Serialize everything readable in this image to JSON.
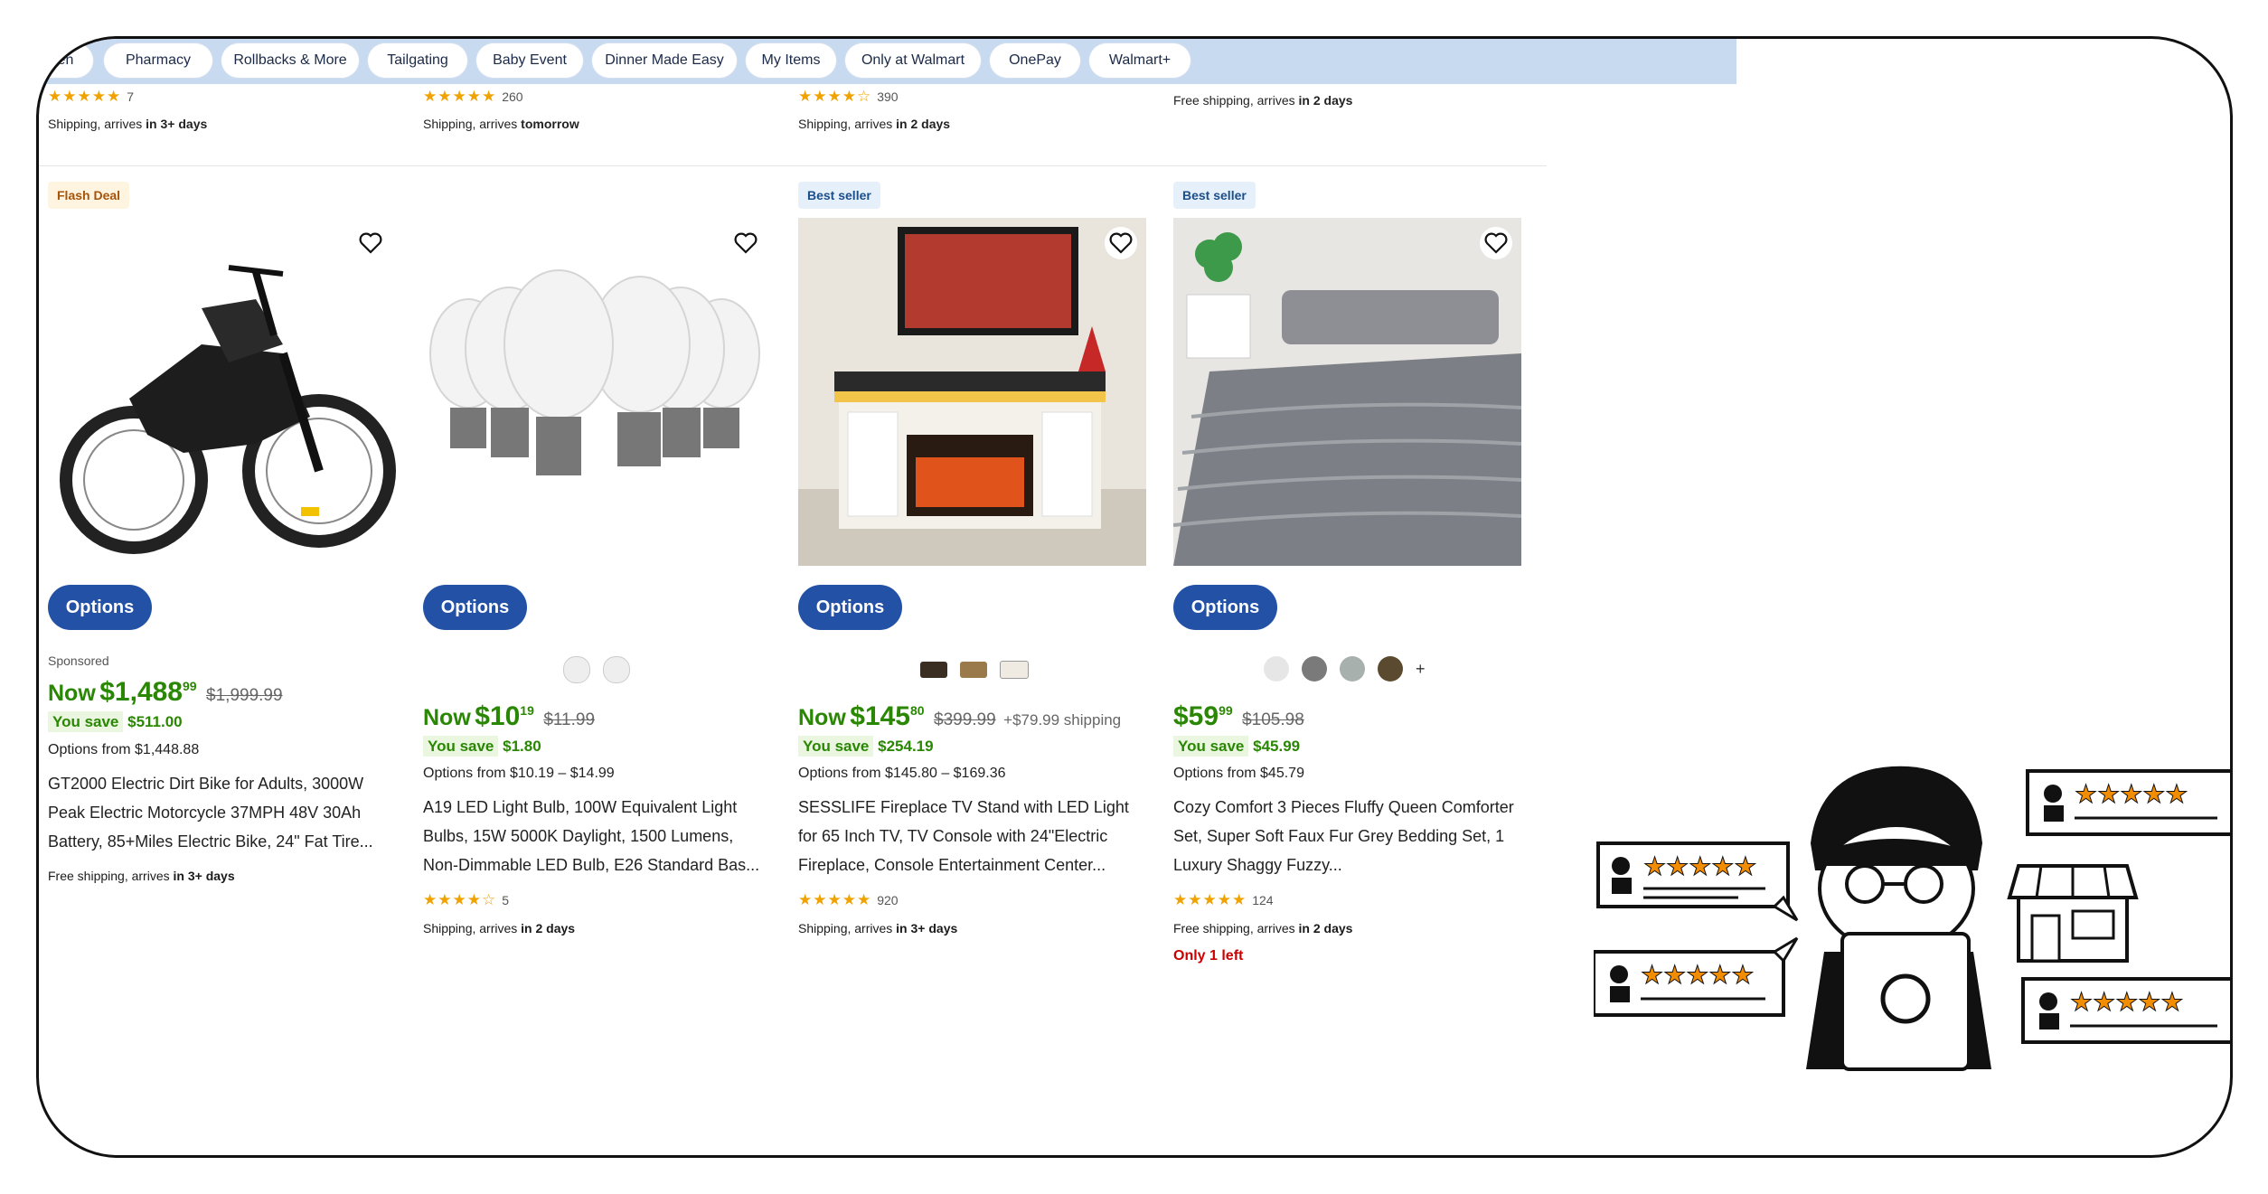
{
  "nav": {
    "items": [
      "een",
      "Pharmacy",
      "Rollbacks & More",
      "Tailgating",
      "Baby Event",
      "Dinner Made Easy",
      "My Items",
      "Only at Walmart",
      "OnePay",
      "Walmart+"
    ]
  },
  "top_row": [
    {
      "rating_count": "7",
      "shipping_prefix": "Shipping, arrives ",
      "shipping_bold": "in 3+ days"
    },
    {
      "rating_count": "260",
      "shipping_prefix": "Shipping, arrives ",
      "shipping_bold": "tomorrow"
    },
    {
      "rating_count": "390",
      "shipping_prefix": "Shipping, arrives ",
      "shipping_bold": "in 2 days"
    },
    {
      "rating_count": "",
      "shipping_prefix": "Free shipping, arrives ",
      "shipping_bold": "in 2 days"
    }
  ],
  "products": [
    {
      "badge": "Flash Deal",
      "options_label": "Options",
      "sponsored": "Sponsored",
      "now_label": "Now",
      "price_dollars": "$1,488",
      "price_cents": "99",
      "was_price": "$1,999.99",
      "you_save_label": "You save",
      "you_save": "$511.00",
      "options_from": "Options from $1,448.88",
      "title": "GT2000 Electric Dirt Bike for Adults, 3000W Peak Electric Motorcycle 37MPH 48V 30Ah Battery, 85+Miles Electric Bike, 24\" Fat Tire...",
      "shipping_prefix": "Free shipping, arrives ",
      "shipping_bold": "in 3+ days"
    },
    {
      "options_label": "Options",
      "now_label": "Now",
      "price_dollars": "$10",
      "price_cents": "19",
      "was_price": "$11.99",
      "you_save_label": "You save",
      "you_save": "$1.80",
      "options_from": "Options from $10.19 – $14.99",
      "title": "A19 LED Light Bulb, 100W Equivalent Light Bulbs, 15W 5000K Daylight, 1500 Lumens, Non-Dimmable LED Bulb, E26 Standard Bas...",
      "rating_count": "5",
      "shipping_prefix": "Shipping, arrives ",
      "shipping_bold": "in 2 days"
    },
    {
      "badge": "Best seller",
      "options_label": "Options",
      "now_label": "Now",
      "price_dollars": "$145",
      "price_cents": "80",
      "was_price": "$399.99",
      "shipping_fee": "+$79.99 shipping",
      "you_save_label": "You save",
      "you_save": "$254.19",
      "options_from": "Options from $145.80 – $169.36",
      "title": "SESSLIFE Fireplace TV Stand with LED Light for 65 Inch TV, TV Console with 24\"Electric Fireplace, Console Entertainment Center...",
      "rating_count": "920",
      "shipping_prefix": "Shipping, arrives ",
      "shipping_bold": "in 3+ days"
    },
    {
      "badge": "Best seller",
      "options_label": "Options",
      "price_dollars": "$59",
      "price_cents": "99",
      "was_price": "$105.98",
      "you_save_label": "You save",
      "you_save": "$45.99",
      "options_from": "Options from $45.79",
      "title": "Cozy Comfort 3 Pieces Fluffy Queen Comforter Set, Super Soft Faux Fur Grey Bedding Set, 1 Luxury Shaggy Fuzzy...",
      "rating_count": "124",
      "shipping_prefix": "Free shipping, arrives ",
      "shipping_bold": "in 2 days",
      "stock_note": "Only 1 left",
      "swatch_more": "+"
    }
  ],
  "colors": {
    "primary_button": "#2251a6",
    "price_green": "#2a8703",
    "star_orange": "#f0a300",
    "nav_bg": "#c8daf0"
  },
  "illustration": {
    "icons": [
      "person-with-laptop-icon",
      "review-bubble-icon",
      "storefront-icon",
      "star-icon"
    ]
  }
}
